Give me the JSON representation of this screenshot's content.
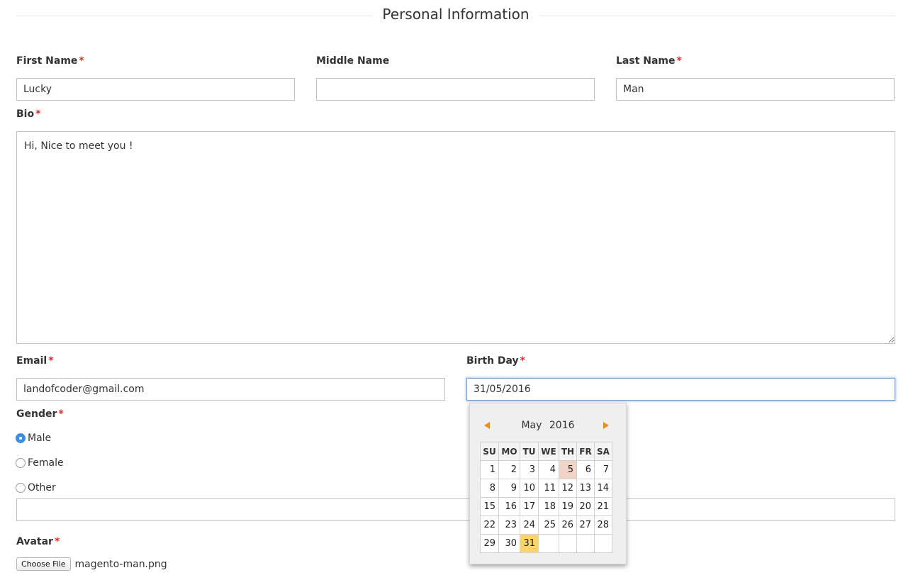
{
  "section": {
    "title": "Personal Information"
  },
  "required_marker": "*",
  "fields": {
    "first_name": {
      "label": "First Name",
      "value": "Lucky"
    },
    "middle_name": {
      "label": "Middle Name",
      "value": ""
    },
    "last_name": {
      "label": "Last Name",
      "value": "Man"
    },
    "bio": {
      "label": "Bio",
      "value": "Hi, Nice to meet you !"
    },
    "email": {
      "label": "Email",
      "value": "landofcoder@gmail.com"
    },
    "birthday": {
      "label": "Birth Day",
      "value": "31/05/2016"
    },
    "gender": {
      "label": "Gender",
      "options": [
        {
          "label": "Male",
          "checked": true
        },
        {
          "label": "Female",
          "checked": false
        },
        {
          "label": "Other",
          "checked": false
        }
      ],
      "other_value": ""
    },
    "avatar": {
      "label": "Avatar",
      "button_label": "Choose File",
      "file_name": "magento-man.png"
    }
  },
  "calendar": {
    "month": "May",
    "year": "2016",
    "weekdays": [
      "SU",
      "MO",
      "TU",
      "WE",
      "TH",
      "FR",
      "SA"
    ],
    "weeks": [
      [
        "1",
        "2",
        "3",
        "4",
        "5",
        "6",
        "7"
      ],
      [
        "8",
        "9",
        "10",
        "11",
        "12",
        "13",
        "14"
      ],
      [
        "15",
        "16",
        "17",
        "18",
        "19",
        "20",
        "21"
      ],
      [
        "22",
        "23",
        "24",
        "25",
        "26",
        "27",
        "28"
      ],
      [
        "29",
        "30",
        "31",
        "",
        "",
        "",
        ""
      ]
    ],
    "today": "5",
    "selected": "31"
  },
  "colors": {
    "required": "#e02b27",
    "calendar_arrow": "#ef8a1c",
    "today_highlight": "#f1d4c8",
    "selected_highlight": "#fad66a",
    "radio_checked": "#3d8ee6"
  }
}
